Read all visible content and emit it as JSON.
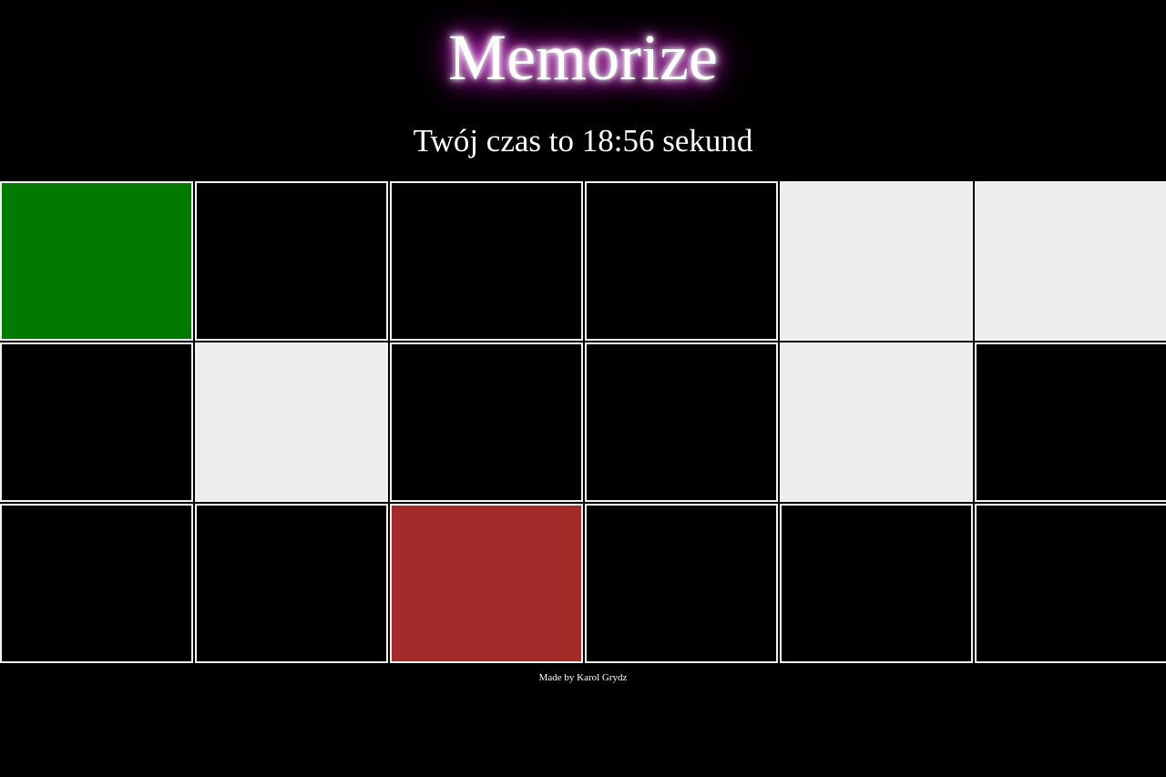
{
  "header": {
    "title": "Memorize",
    "timer_text": "Twój czas to 18:56 sekund"
  },
  "board": {
    "columns": 6,
    "rows": 3,
    "tiles": [
      {
        "state": "green",
        "color": "#007b00"
      },
      {
        "state": "hidden",
        "color": "#000000"
      },
      {
        "state": "hidden",
        "color": "#000000"
      },
      {
        "state": "hidden",
        "color": "#000000"
      },
      {
        "state": "light",
        "color": "#ededed"
      },
      {
        "state": "light",
        "color": "#ededed"
      },
      {
        "state": "hidden",
        "color": "#000000"
      },
      {
        "state": "light",
        "color": "#ededed"
      },
      {
        "state": "hidden",
        "color": "#000000"
      },
      {
        "state": "hidden",
        "color": "#000000"
      },
      {
        "state": "light",
        "color": "#ededed"
      },
      {
        "state": "hidden",
        "color": "#000000"
      },
      {
        "state": "hidden",
        "color": "#000000"
      },
      {
        "state": "hidden",
        "color": "#000000"
      },
      {
        "state": "red",
        "color": "#a52a2a"
      },
      {
        "state": "hidden",
        "color": "#000000"
      },
      {
        "state": "hidden",
        "color": "#000000"
      },
      {
        "state": "hidden",
        "color": "#000000"
      }
    ]
  },
  "footer": {
    "credit": "Made by Karol Grydz"
  },
  "colors": {
    "background": "#000000",
    "glow": "#cc00cc",
    "tile_border": "#f2f2f2"
  }
}
